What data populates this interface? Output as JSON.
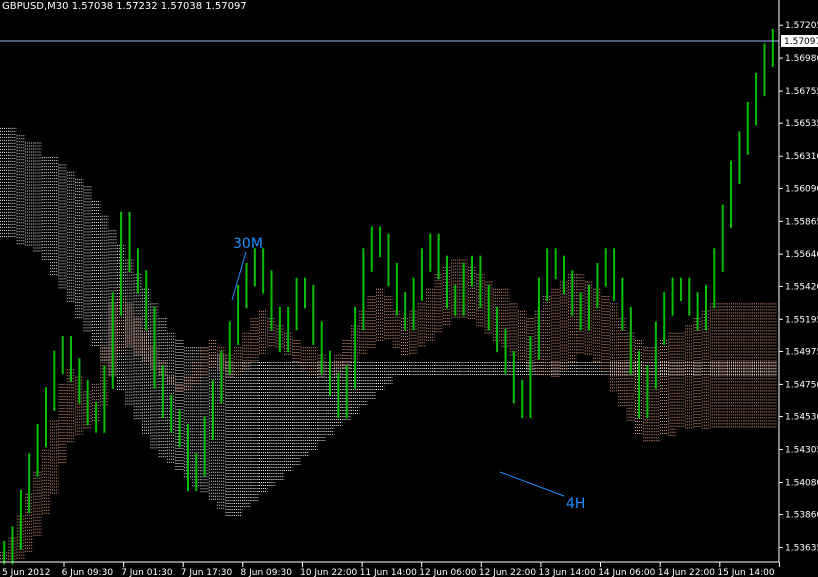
{
  "window": {
    "symbol_line": "GBPUSD,M30  1.57038 1.57232 1.57038 1.57097"
  },
  "colors": {
    "background": "#000000",
    "axis": "#ffffff",
    "candle": "#00c000",
    "cloud_30m": "#f4a98c",
    "cloud_4h": "#ffffff",
    "price_line": "#8fb6ff",
    "annotation": "#1e90ff"
  },
  "chart_data": {
    "type": "line",
    "title": "GBPUSD,M30  1.57038 1.57232 1.57038 1.57097",
    "current_price": "1.57097",
    "ylim": [
      1.5355,
      1.5735
    ],
    "y_ticks": [
      "1.57205",
      "1.56980",
      "1.56755",
      "1.56535",
      "1.56310",
      "1.56090",
      "1.55865",
      "1.55640",
      "1.55420",
      "1.55195",
      "1.54975",
      "1.54750",
      "1.54530",
      "1.54305",
      "1.54080",
      "1.53860",
      "1.53635"
    ],
    "x_ticks": [
      "5 Jun 2012",
      "6 Jun 09:30",
      "7 Jun 01:30",
      "7 Jun 17:30",
      "8 Jun 09:30",
      "10 Jun 22:00",
      "11 Jun 14:00",
      "12 Jun 06:00",
      "12 Jun 22:00",
      "13 Jun 14:00",
      "14 Jun 06:00",
      "14 Jun 22:00",
      "15 Jun 14:00"
    ],
    "annotations": [
      {
        "label": "30M",
        "target": "30-minute cloud"
      },
      {
        "label": "4H",
        "target": "4-hour cloud"
      }
    ],
    "series": [
      {
        "kind": "price",
        "values": [
          1.536,
          1.537,
          1.5395,
          1.542,
          1.544,
          1.5465,
          1.549,
          1.55,
          1.5485,
          1.547,
          1.5455,
          1.545,
          1.548,
          1.553,
          1.5585,
          1.556,
          1.5545,
          1.552,
          1.548,
          1.546,
          1.545,
          1.544,
          1.541,
          1.542,
          1.5445,
          1.547,
          1.549,
          1.551,
          1.5535,
          1.555,
          1.556,
          1.5545,
          1.552,
          1.5505,
          1.552,
          1.554,
          1.5535,
          1.551,
          1.549,
          1.5475,
          1.546,
          1.548,
          1.552,
          1.556,
          1.5575,
          1.557,
          1.555,
          1.553,
          1.552,
          1.554,
          1.556,
          1.557,
          1.5555,
          1.5535,
          1.553,
          1.555,
          1.5555,
          1.5535,
          1.552,
          1.5505,
          1.549,
          1.547,
          1.546,
          1.55,
          1.554,
          1.556,
          1.5555,
          1.5545,
          1.553,
          1.552,
          1.5535,
          1.555,
          1.556,
          1.554,
          1.552,
          1.549,
          1.546,
          1.548,
          1.551,
          1.553,
          1.554,
          1.554,
          1.553,
          1.552,
          1.5535,
          1.556,
          1.559,
          1.562,
          1.564,
          1.566,
          1.568,
          1.57,
          1.571
        ]
      },
      {
        "kind": "cloud",
        "name": "30M",
        "upper": [
          1.536,
          1.537,
          1.5385,
          1.54,
          1.5415,
          1.543,
          1.545,
          1.5475,
          1.5485,
          1.548,
          1.547,
          1.5475,
          1.55,
          1.553,
          1.5535,
          1.553,
          1.552,
          1.551,
          1.55,
          1.549,
          1.548,
          1.5475,
          1.548,
          1.549,
          1.55,
          1.5505,
          1.55,
          1.5495,
          1.55,
          1.551,
          1.552,
          1.5525,
          1.552,
          1.5515,
          1.551,
          1.5505,
          1.55,
          1.55,
          1.5495,
          1.549,
          1.5495,
          1.5505,
          1.5515,
          1.5525,
          1.5535,
          1.554,
          1.5535,
          1.5525,
          1.552,
          1.5525,
          1.553,
          1.554,
          1.555,
          1.5555,
          1.556,
          1.556,
          1.5555,
          1.555,
          1.5545,
          1.554,
          1.554,
          1.553,
          1.5525,
          1.552,
          1.5525,
          1.5535,
          1.554,
          1.5545,
          1.555,
          1.555,
          1.5545,
          1.554,
          1.5535,
          1.553,
          1.552,
          1.551,
          1.5505,
          1.55,
          1.55,
          1.5505,
          1.551,
          1.551,
          1.5515,
          1.552,
          1.5525,
          1.553,
          1.553,
          1.553,
          1.553,
          1.553,
          1.553,
          1.553,
          1.553
        ],
        "lower": [
          1.5355,
          1.5355,
          1.5355,
          1.536,
          1.537,
          1.5385,
          1.54,
          1.542,
          1.5435,
          1.544,
          1.5445,
          1.545,
          1.546,
          1.548,
          1.5495,
          1.55,
          1.5495,
          1.549,
          1.5485,
          1.548,
          1.5475,
          1.547,
          1.547,
          1.5475,
          1.548,
          1.5485,
          1.5485,
          1.548,
          1.548,
          1.5485,
          1.549,
          1.5495,
          1.55,
          1.55,
          1.5495,
          1.549,
          1.5485,
          1.548,
          1.548,
          1.548,
          1.548,
          1.5485,
          1.549,
          1.5495,
          1.55,
          1.5505,
          1.5505,
          1.55,
          1.5495,
          1.5495,
          1.55,
          1.5505,
          1.551,
          1.5515,
          1.552,
          1.552,
          1.552,
          1.5515,
          1.551,
          1.5505,
          1.55,
          1.5495,
          1.549,
          1.5485,
          1.548,
          1.548,
          1.548,
          1.5485,
          1.549,
          1.5495,
          1.5495,
          1.549,
          1.5485,
          1.547,
          1.546,
          1.545,
          1.544,
          1.5435,
          1.5435,
          1.544,
          1.544,
          1.5445,
          1.5445,
          1.5445,
          1.5445,
          1.5445,
          1.5445,
          1.5445,
          1.5445,
          1.5445,
          1.5445,
          1.5445,
          1.5445
        ]
      },
      {
        "kind": "cloud",
        "name": "4H",
        "upper": [
          1.565,
          1.565,
          1.5645,
          1.564,
          1.564,
          1.563,
          1.563,
          1.5625,
          1.562,
          1.5615,
          1.561,
          1.56,
          1.559,
          1.558,
          1.557,
          1.556,
          1.555,
          1.554,
          1.553,
          1.552,
          1.551,
          1.5505,
          1.55,
          1.55,
          1.55,
          1.5495,
          1.5495,
          1.549,
          1.549,
          1.549,
          1.549,
          1.549,
          1.549,
          1.549,
          1.549,
          1.549,
          1.549,
          1.549,
          1.549,
          1.549,
          1.549,
          1.549,
          1.549,
          1.549,
          1.549,
          1.549,
          1.549,
          1.549,
          1.549,
          1.549,
          1.549,
          1.549,
          1.549,
          1.549,
          1.549,
          1.549,
          1.549,
          1.549,
          1.549,
          1.549,
          1.549,
          1.549,
          1.549,
          1.549,
          1.549,
          1.549,
          1.549,
          1.549,
          1.549,
          1.549,
          1.549,
          1.549,
          1.549,
          1.549,
          1.549,
          1.549,
          1.549,
          1.549,
          1.549,
          1.549,
          1.549,
          1.549,
          1.549,
          1.549,
          1.549,
          1.549,
          1.549,
          1.549,
          1.549,
          1.549,
          1.549,
          1.549,
          1.549
        ],
        "lower": [
          1.5575,
          1.5575,
          1.557,
          1.557,
          1.5565,
          1.556,
          1.555,
          1.554,
          1.553,
          1.552,
          1.551,
          1.55,
          1.549,
          1.548,
          1.547,
          1.546,
          1.545,
          1.544,
          1.543,
          1.5425,
          1.542,
          1.5415,
          1.541,
          1.5405,
          1.54,
          1.5395,
          1.539,
          1.5385,
          1.5385,
          1.539,
          1.5395,
          1.54,
          1.5405,
          1.541,
          1.5415,
          1.542,
          1.5425,
          1.543,
          1.5435,
          1.544,
          1.5445,
          1.545,
          1.5455,
          1.546,
          1.5465,
          1.547,
          1.5475,
          1.548,
          1.548,
          1.548,
          1.548,
          1.548,
          1.548,
          1.548,
          1.548,
          1.548,
          1.548,
          1.548,
          1.548,
          1.548,
          1.548,
          1.548,
          1.548,
          1.548,
          1.548,
          1.548,
          1.548,
          1.548,
          1.548,
          1.548,
          1.548,
          1.548,
          1.548,
          1.548,
          1.548,
          1.548,
          1.548,
          1.548,
          1.548,
          1.548,
          1.548,
          1.548,
          1.548,
          1.548,
          1.548,
          1.548,
          1.548,
          1.548,
          1.548,
          1.548,
          1.548,
          1.548,
          1.548
        ]
      }
    ]
  }
}
